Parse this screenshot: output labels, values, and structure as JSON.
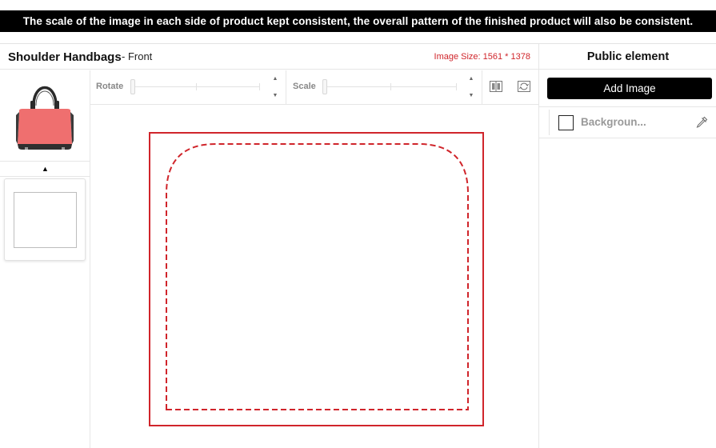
{
  "notice": "The scale of the image in each side of product kept consistent, the overall pattern of the finished product will also be consistent.",
  "header": {
    "product_title": "Shoulder Handbags",
    "side": "- Front",
    "image_size": "Image Size: 1561 * 1378"
  },
  "toolbar": {
    "rotate_label": "Rotate",
    "scale_label": "Scale",
    "stepper_up": "▲",
    "stepper_down": "▼"
  },
  "thumbs": {
    "scroll_up": "▲"
  },
  "panel": {
    "title": "Public element",
    "add_image_label": "Add Image",
    "elements": [
      {
        "name": "Backgroun..."
      }
    ]
  },
  "colors": {
    "cut_line": "#d0252b",
    "bag": "#ef6f6f",
    "button": "#000000"
  },
  "icons": [
    "caret-up-icon",
    "caret-down-icon",
    "flip-icon",
    "reset-rotate-icon",
    "color-swatch-icon",
    "eyedropper-icon",
    "handbag-thumbnail"
  ]
}
